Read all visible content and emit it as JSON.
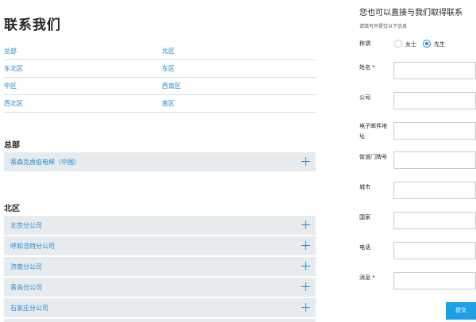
{
  "page": {
    "title": "联系我们"
  },
  "regions": [
    [
      "总部",
      "北区"
    ],
    [
      "东北区",
      "东区"
    ],
    [
      "中区",
      "西南区"
    ],
    [
      "西北区",
      "南区"
    ]
  ],
  "sections": [
    {
      "title": "总部",
      "items": [
        "蒂森克虏伯电梯（中国）"
      ]
    },
    {
      "title": "北区",
      "items": [
        "北京分公司",
        "呼和浩特分公司",
        "济南分公司",
        "青岛分公司",
        "石家庄分公司"
      ]
    }
  ],
  "form": {
    "title": "您也可以直接与我们取得联系",
    "subtitle": "请填写并提交以下信息",
    "salutation_label": "称谓",
    "salutation_options": [
      {
        "label": "女士",
        "selected": false
      },
      {
        "label": "先生",
        "selected": true
      }
    ],
    "fields": [
      {
        "label": "姓名 *",
        "value": ""
      },
      {
        "label": "公司",
        "value": ""
      },
      {
        "label": "电子邮件地址",
        "value": ""
      },
      {
        "label": "街道门牌号",
        "value": ""
      },
      {
        "label": "城市",
        "value": ""
      },
      {
        "label": "国家",
        "value": ""
      },
      {
        "label": "电话",
        "value": ""
      },
      {
        "label": "消息 *",
        "value": ""
      }
    ],
    "submit_label": "提交"
  },
  "colors": {
    "link": "#1e88d2",
    "accordion_bg": "#e8ebee",
    "submit_bg": "#1ea0e6"
  }
}
